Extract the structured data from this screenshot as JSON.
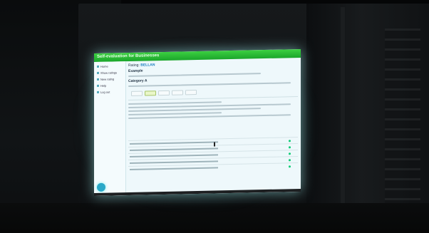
{
  "scene": {
    "description": "",
    "screen": {
      "header": {
        "title": "Self-evaluation for Businesses",
        "right_text": ""
      },
      "sidebar": {
        "items": [
          {
            "label": "Home"
          },
          {
            "label": "Show ratings"
          },
          {
            "label": "New rating"
          },
          {
            "label": "Help"
          },
          {
            "label": "Log out"
          }
        ]
      },
      "main": {
        "rating_label": "Rating:",
        "rating_value": "BELLAN",
        "section_title": "Example",
        "subsection": "Category A"
      }
    }
  }
}
